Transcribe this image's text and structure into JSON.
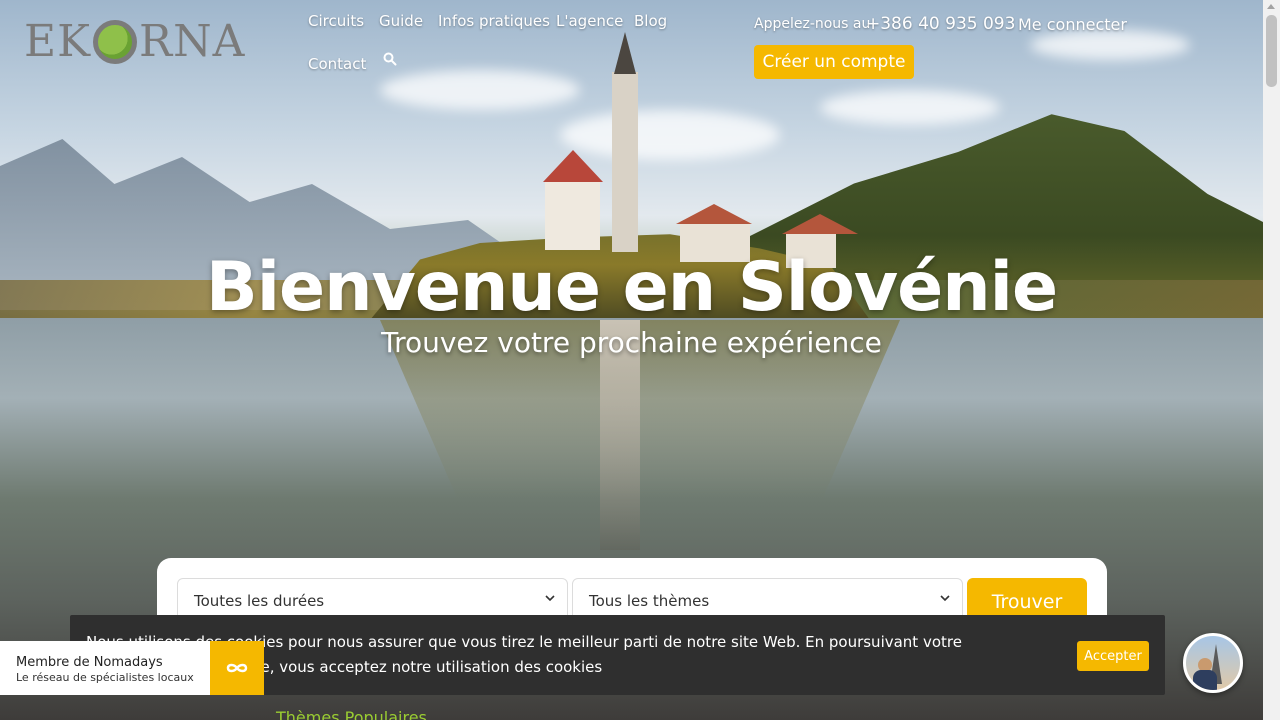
{
  "logo": {
    "text_left": "EK",
    "text_right": "RNA"
  },
  "nav": {
    "items": [
      {
        "label": "Circuits"
      },
      {
        "label": "Guide"
      },
      {
        "label": "Infos pratiques"
      },
      {
        "label": "L'agence"
      },
      {
        "label": "Blog"
      },
      {
        "label": "Contact"
      }
    ],
    "search_icon": "search-icon"
  },
  "header_right": {
    "phone_label": "Appelez-nous au",
    "phone": "+386 40 935 093",
    "login": "Me connecter",
    "create_account": "Créer un compte"
  },
  "hero": {
    "title": "Bienvenue en Slovénie",
    "subtitle": "Trouvez votre prochaine expérience"
  },
  "search": {
    "duration_value": "Toutes les durées",
    "theme_value": "Tous les thèmes",
    "find_button": "Trouver"
  },
  "cookie": {
    "text": "Nous utilisons des cookies pour nous assurer que vous tirez le meilleur parti de notre site Web. En poursuivant votre navigation sur notre site, vous acceptez notre utilisation des cookies",
    "accept": "Accepter"
  },
  "nomadays": {
    "title": "Membre de Nomadays",
    "subtitle": "Le réseau de spécialistes locaux"
  },
  "teaser": {
    "text": "Thèmes Populaires"
  },
  "colors": {
    "accent": "#f5b800",
    "cookie_bg": "#2f2f2f",
    "green": "#8fc04a"
  }
}
